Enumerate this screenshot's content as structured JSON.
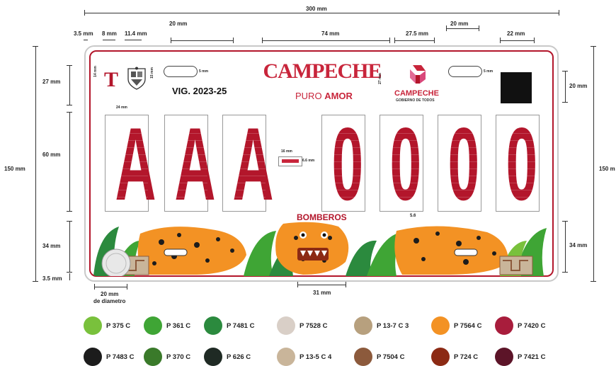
{
  "dimensions": {
    "total_width": "300 mm",
    "top": [
      "3.5 mm",
      "8 mm",
      "11.4 mm",
      "20 mm",
      "74 mm",
      "27.5 mm",
      "20 mm",
      "22 mm"
    ],
    "left": [
      "27 mm",
      "60 mm",
      "34 mm",
      "3.5 mm"
    ],
    "total_height_left": "150 mm",
    "total_height_right": "150 m",
    "right": [
      "20 mm",
      "34 mm"
    ],
    "bottom_left": "20 mm",
    "bottom_left_sub": "de diametro",
    "bottom_center": "31 mm",
    "inner_small": [
      "14 mm",
      "15 mm",
      "24 mm",
      "5 mm",
      "5 mm",
      "27 mm",
      "16 mm",
      "6.6 mm",
      "5.6"
    ]
  },
  "plate": {
    "type_letter": "T",
    "validity": "VIG. 2023-25",
    "state_name": "CAMPECHE",
    "slogan_thin": "PURO",
    "slogan_bold": "AMOR",
    "gov_name": "CAMPECHE",
    "gov_sub": "GOBIERNO DE TODOS",
    "characters": [
      "A",
      "A",
      "A",
      "0",
      "0",
      "0",
      "0"
    ],
    "separator": "-",
    "service": "BOMBEROS"
  },
  "swatches": [
    {
      "label": "P 375 C",
      "color": "#79c13c"
    },
    {
      "label": "P 361 C",
      "color": "#3fa535"
    },
    {
      "label": "P 7481 C",
      "color": "#2b8a3e"
    },
    {
      "label": "P 7528 C",
      "color": "#d9cfc7"
    },
    {
      "label": "P 13-7 C 3",
      "color": "#b7a07e"
    },
    {
      "label": "P 7564 C",
      "color": "#f39224"
    },
    {
      "label": "P 7420 C",
      "color": "#a81d3c"
    },
    {
      "label": "P 7483 C",
      "color": "#1c1c1c"
    },
    {
      "label": "P 370 C",
      "color": "#3a7a2a"
    },
    {
      "label": "P 626 C",
      "color": "#1f2a24"
    },
    {
      "label": "P 13-5 C 4",
      "color": "#c9b59a"
    },
    {
      "label": "P 7504 C",
      "color": "#8c5a3c"
    },
    {
      "label": "P 724 C",
      "color": "#8c2a14"
    },
    {
      "label": "P 7421 C",
      "color": "#5c1428"
    }
  ],
  "colors": {
    "accent_red": "#b3162b",
    "logo_red": "#c8253b",
    "logo_pink": "#d9487a"
  }
}
